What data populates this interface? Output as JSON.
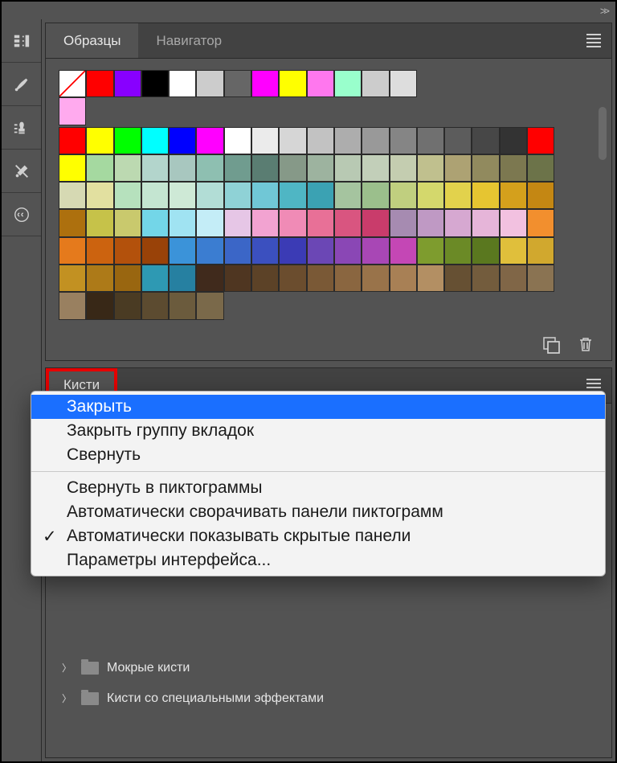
{
  "topbar": {
    "expand_glyph": ">>"
  },
  "sidebar": {
    "items": [
      {
        "name": "libraries-icon"
      },
      {
        "name": "brush-icon"
      },
      {
        "name": "stamp-icon"
      },
      {
        "name": "tools-icon"
      },
      {
        "name": "cc-icon"
      }
    ]
  },
  "swatches_panel": {
    "tabs": [
      {
        "label": "Образцы",
        "active": true
      },
      {
        "label": "Навигатор",
        "active": false
      }
    ],
    "top_row_colors": [
      "none",
      "#ff0000",
      "#8800ff",
      "#000000",
      "#ffffff",
      "#cccccc",
      "#666666",
      "#ff00ff",
      "#ffff00",
      "#ff77ee",
      "#99ffcc",
      "#cccccc",
      "#dddddd",
      "#ffaaee"
    ],
    "main_grid_colors": [
      "#ff0000",
      "#ffff00",
      "#00ff00",
      "#00ffff",
      "#0000ff",
      "#ff00ff",
      "#ffffff",
      "#ebebeb",
      "#d6d6d6",
      "#c2c2c2",
      "#adadad",
      "#999999",
      "#858585",
      "#707070",
      "#5c5c5c",
      "#474747",
      "#333333",
      "#ff0000",
      "#ffff00",
      "#a5d9a0",
      "#bcd9b1",
      "#b3d5cc",
      "#a8c7bf",
      "#8ebfb1",
      "#709c8f",
      "#5a7d72",
      "#869988",
      "#9db39f",
      "#b8c9b3",
      "#c2cfb9",
      "#c4cdb0",
      "#c0c08e",
      "#ada273",
      "#918a5e",
      "#7c7850",
      "#6c7349",
      "#d6d9b3",
      "#e2e0a0",
      "#b6e1bd",
      "#c4e5d1",
      "#cee9d6",
      "#b2ddd6",
      "#8fd2d6",
      "#70c7d6",
      "#4fb6c4",
      "#3ba2b3",
      "#a5c49f",
      "#9bbf8c",
      "#c0cf7f",
      "#d4d86c",
      "#e2d24c",
      "#e6c531",
      "#d4a01c",
      "#c48713",
      "#ad700e",
      "#c6c249",
      "#c9c96d",
      "#73d6e8",
      "#a0e3f2",
      "#c4edf7",
      "#e6c6e6",
      "#f2a3d1",
      "#f08bb6",
      "#e87097",
      "#d95580",
      "#c93c6b",
      "#a68bb1",
      "#bf99c4",
      "#d6a8d1",
      "#e6b5d9",
      "#f2c1e0",
      "#f28f2e",
      "#e57a1c",
      "#cc630f",
      "#b3510c",
      "#994208",
      "#3b93d9",
      "#3b7dd1",
      "#3b66c7",
      "#3b50bf",
      "#3b3bb5",
      "#6b47b5",
      "#8a47b5",
      "#a847b5",
      "#c447b5",
      "#7e9c2e",
      "#6b8a26",
      "#5a781f",
      "#e0bf3b",
      "#d1a82e",
      "#c29122",
      "#ad7a18",
      "#996610",
      "#2e99b3",
      "#2680a1",
      "#402a1c",
      "#4f3621",
      "#5c4227",
      "#6b4d2e",
      "#7a5936",
      "#8a6640",
      "#99734a",
      "#a88055",
      "#b38f63",
      "#665033",
      "#735c3d",
      "#806647",
      "#8a7352",
      "#998060",
      "#382817",
      "#4a3b23",
      "#5c4b30",
      "#6b5b3d",
      "#7a694a"
    ],
    "footer_icons": [
      "new-swatch-icon",
      "trash-icon"
    ]
  },
  "brushes_panel": {
    "tabs": [
      {
        "label": "Кисти",
        "active": true
      }
    ],
    "folders": [
      {
        "label": "Мокрые кисти"
      },
      {
        "label": "Кисти со специальными эффектами"
      }
    ]
  },
  "context_menu": {
    "items": [
      {
        "label": "Закрыть",
        "selected": true
      },
      {
        "label": "Закрыть группу вкладок"
      },
      {
        "label": "Свернуть"
      },
      {
        "sep": true
      },
      {
        "label": "Свернуть в пиктограммы"
      },
      {
        "label": "Автоматически сворачивать панели пиктограмм"
      },
      {
        "label": "Автоматически показывать скрытые панели",
        "checked": true
      },
      {
        "label": "Параметры интерфейса..."
      }
    ]
  }
}
